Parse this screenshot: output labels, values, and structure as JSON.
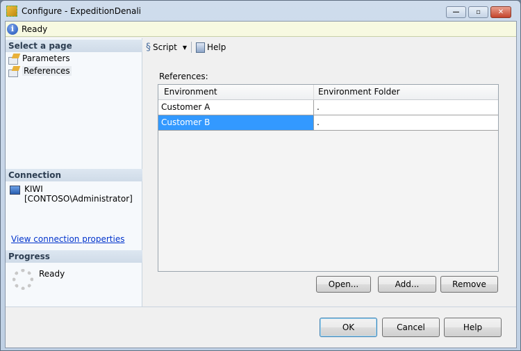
{
  "window": {
    "title": "Configure - ExpeditionDenali",
    "controls": {
      "minimize": "—",
      "maximize": "▫",
      "close": "✕"
    }
  },
  "status": {
    "text": "Ready",
    "icon": "info-icon"
  },
  "left": {
    "select_header": "Select a page",
    "pages": [
      {
        "label": "Parameters"
      },
      {
        "label": "References"
      }
    ],
    "connection_header": "Connection",
    "server": "KIWI",
    "user": "[CONTOSO\\Administrator]",
    "view_link": "View connection properties",
    "progress_header": "Progress",
    "progress_status": "Ready"
  },
  "toolbar": {
    "script": "Script",
    "help": "Help"
  },
  "references": {
    "label": "References:",
    "columns": [
      "Environment",
      "Environment Folder"
    ],
    "rows": [
      {
        "environment": "Customer A",
        "folder": "."
      },
      {
        "environment": "Customer B",
        "folder": "."
      }
    ],
    "selected_row": 1,
    "selection_color": "#3399ff"
  },
  "buttons": {
    "open": "Open...",
    "add": "Add...",
    "remove": "Remove",
    "ok": "OK",
    "cancel": "Cancel",
    "help": "Help"
  }
}
